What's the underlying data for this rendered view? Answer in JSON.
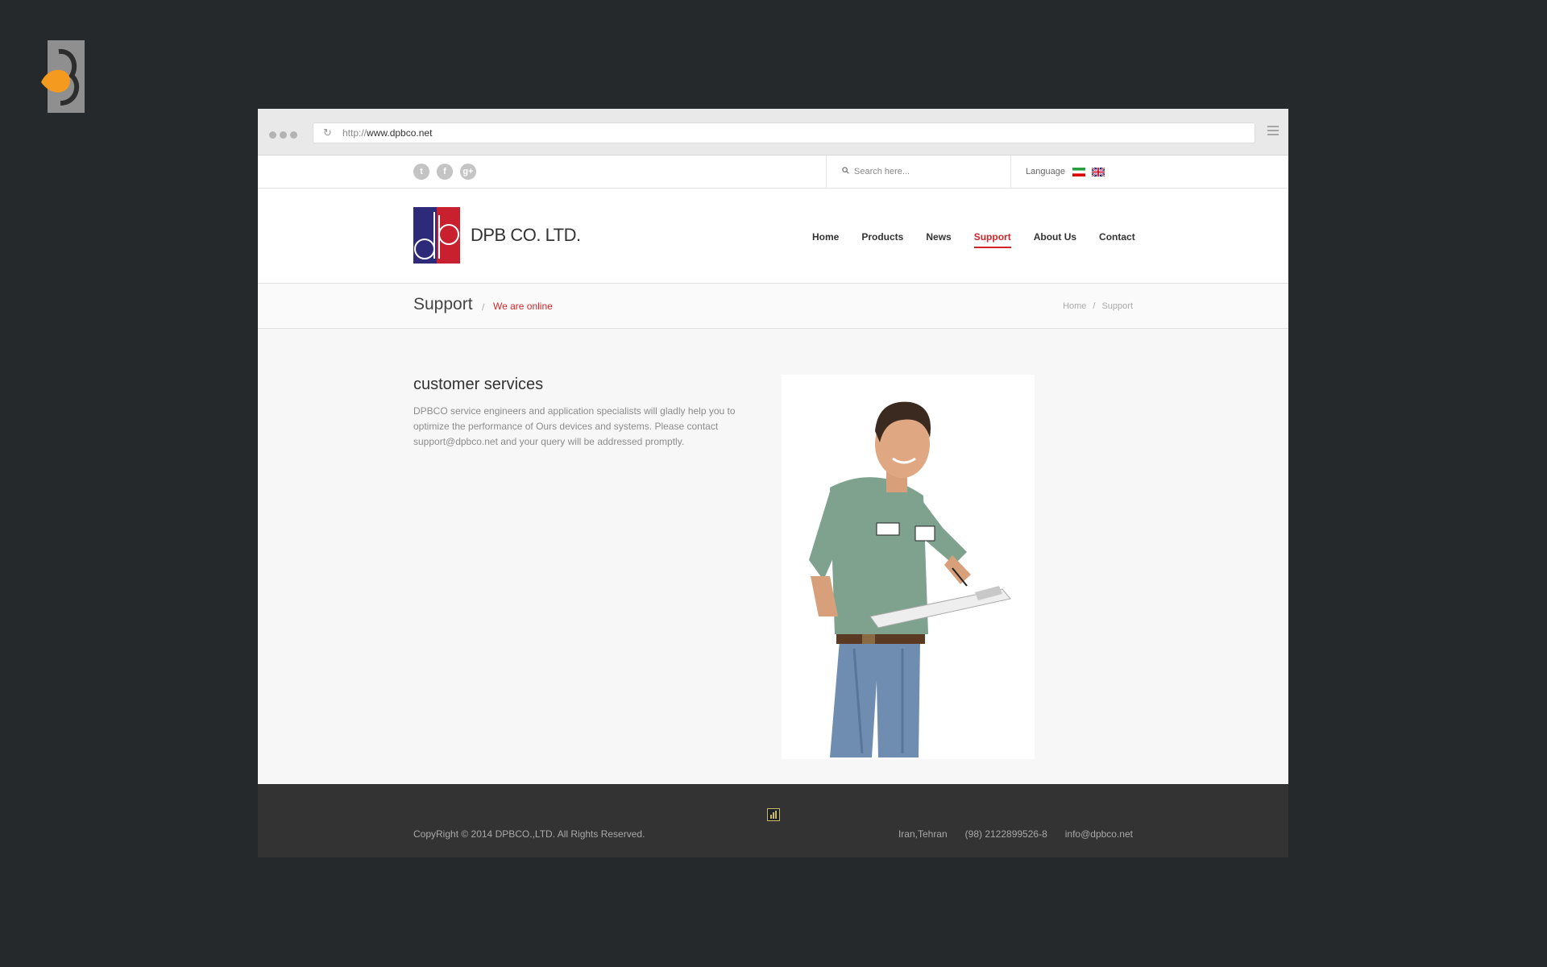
{
  "browser": {
    "url_protocol": "http://",
    "url_host": "www.dpbco.net"
  },
  "topbar": {
    "social": [
      "t",
      "f",
      "g+"
    ],
    "search_placeholder": "Search here...",
    "language_label": "Language"
  },
  "header": {
    "company_name": "DPB CO. LTD.",
    "nav": [
      "Home",
      "Products",
      "News",
      "Support",
      "About Us",
      "Contact"
    ],
    "active_nav": "Support"
  },
  "page_title": {
    "title": "Support",
    "separator": "/",
    "subtitle": "We are online",
    "breadcrumb": [
      "Home",
      "Support"
    ],
    "breadcrumb_separator": "/"
  },
  "content": {
    "heading": "customer services",
    "paragraph": "DPBCO service engineers and application specialists will gladly help you to optimize the performance of Ours devices and systems. Please contact support@dpbco.net and your query will be addressed promptly."
  },
  "footer": {
    "copyright": "CopyRight © 2014 DPBCO.,LTD. All Rights Reserved.",
    "location": "Iran,Tehran",
    "phone": "(98) 2122899526-8",
    "email": "info@dpbco.net"
  },
  "colors": {
    "accent": "#d0262a",
    "logo_blue": "#2d2a7a",
    "logo_red": "#c8202e",
    "background": "#25292c",
    "footer": "#333333"
  }
}
